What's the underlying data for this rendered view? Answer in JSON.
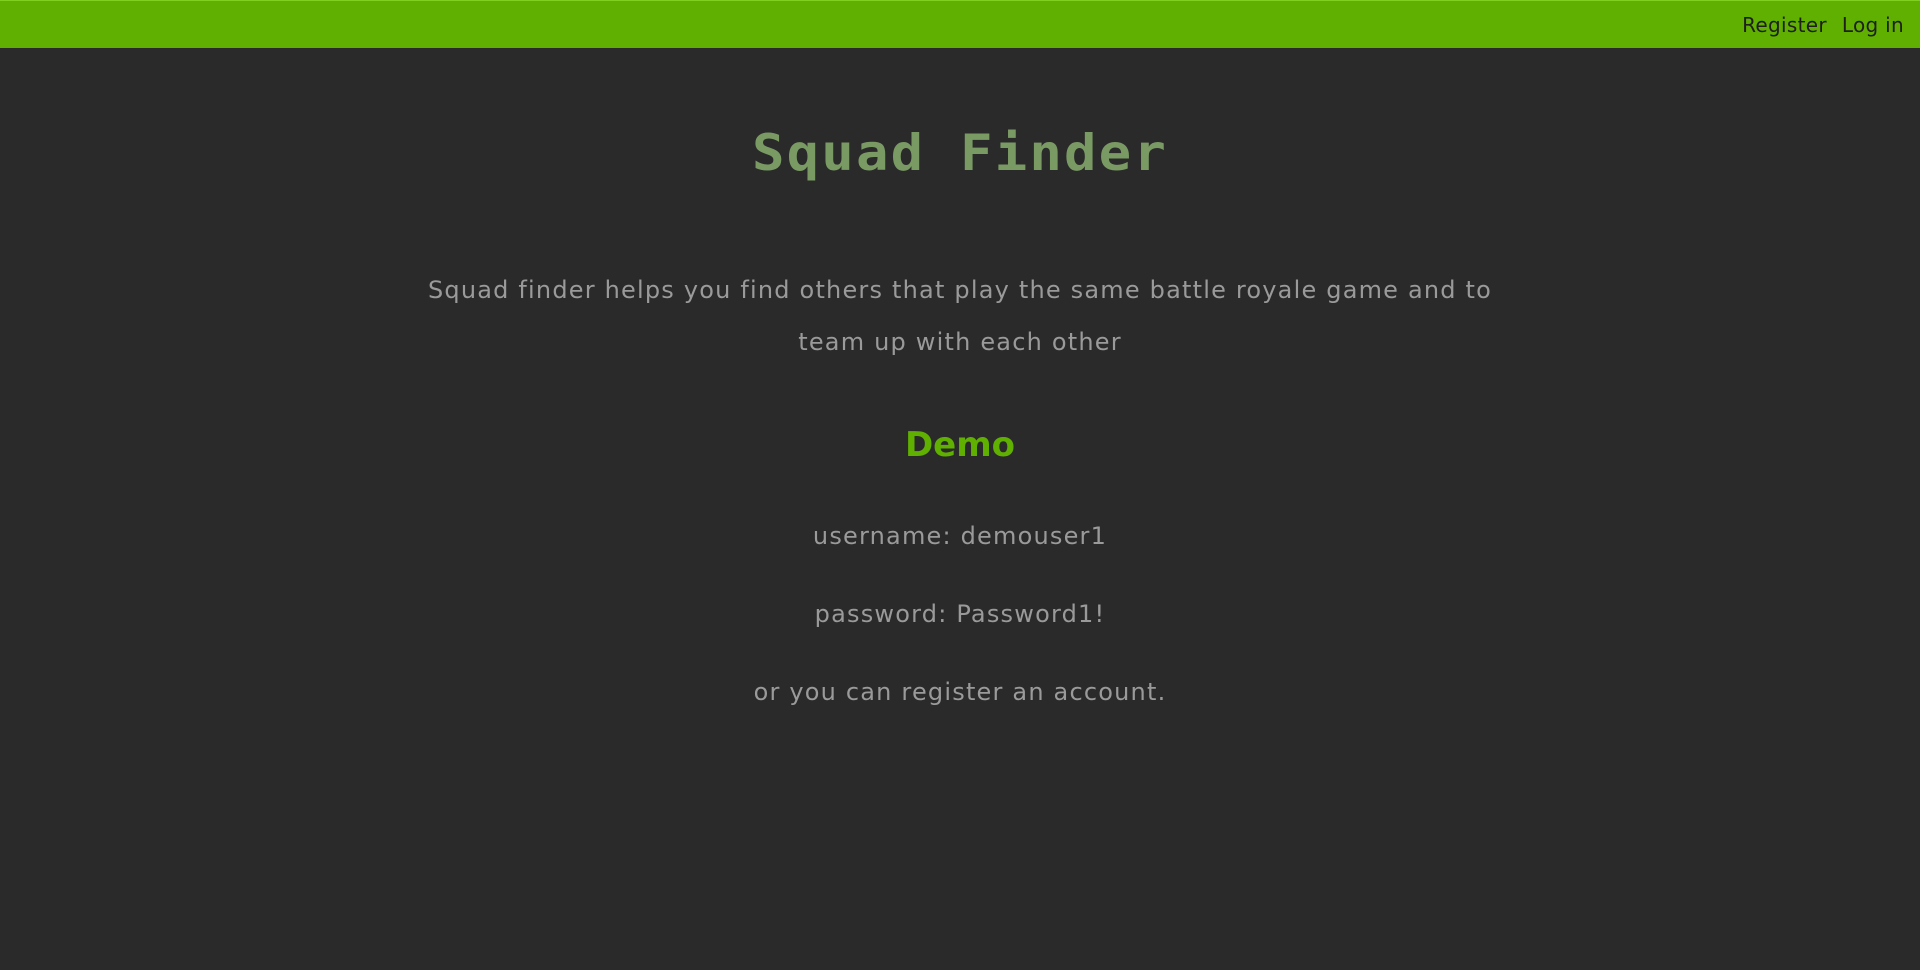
{
  "nav": {
    "register_label": "Register",
    "login_label": "Log in"
  },
  "page": {
    "title": "Squad Finder",
    "intro": "Squad finder helps you find others that play the same battle royale game and to team up with each other",
    "demo_heading": "Demo",
    "username_line": "username: demouser1",
    "password_line": "password: Password1!",
    "register_note": "or you can register an account."
  },
  "colors": {
    "accent": "#5fb000",
    "background": "#2a2a2a",
    "title": "#7a9a64",
    "body_text": "#9a9a9a"
  }
}
